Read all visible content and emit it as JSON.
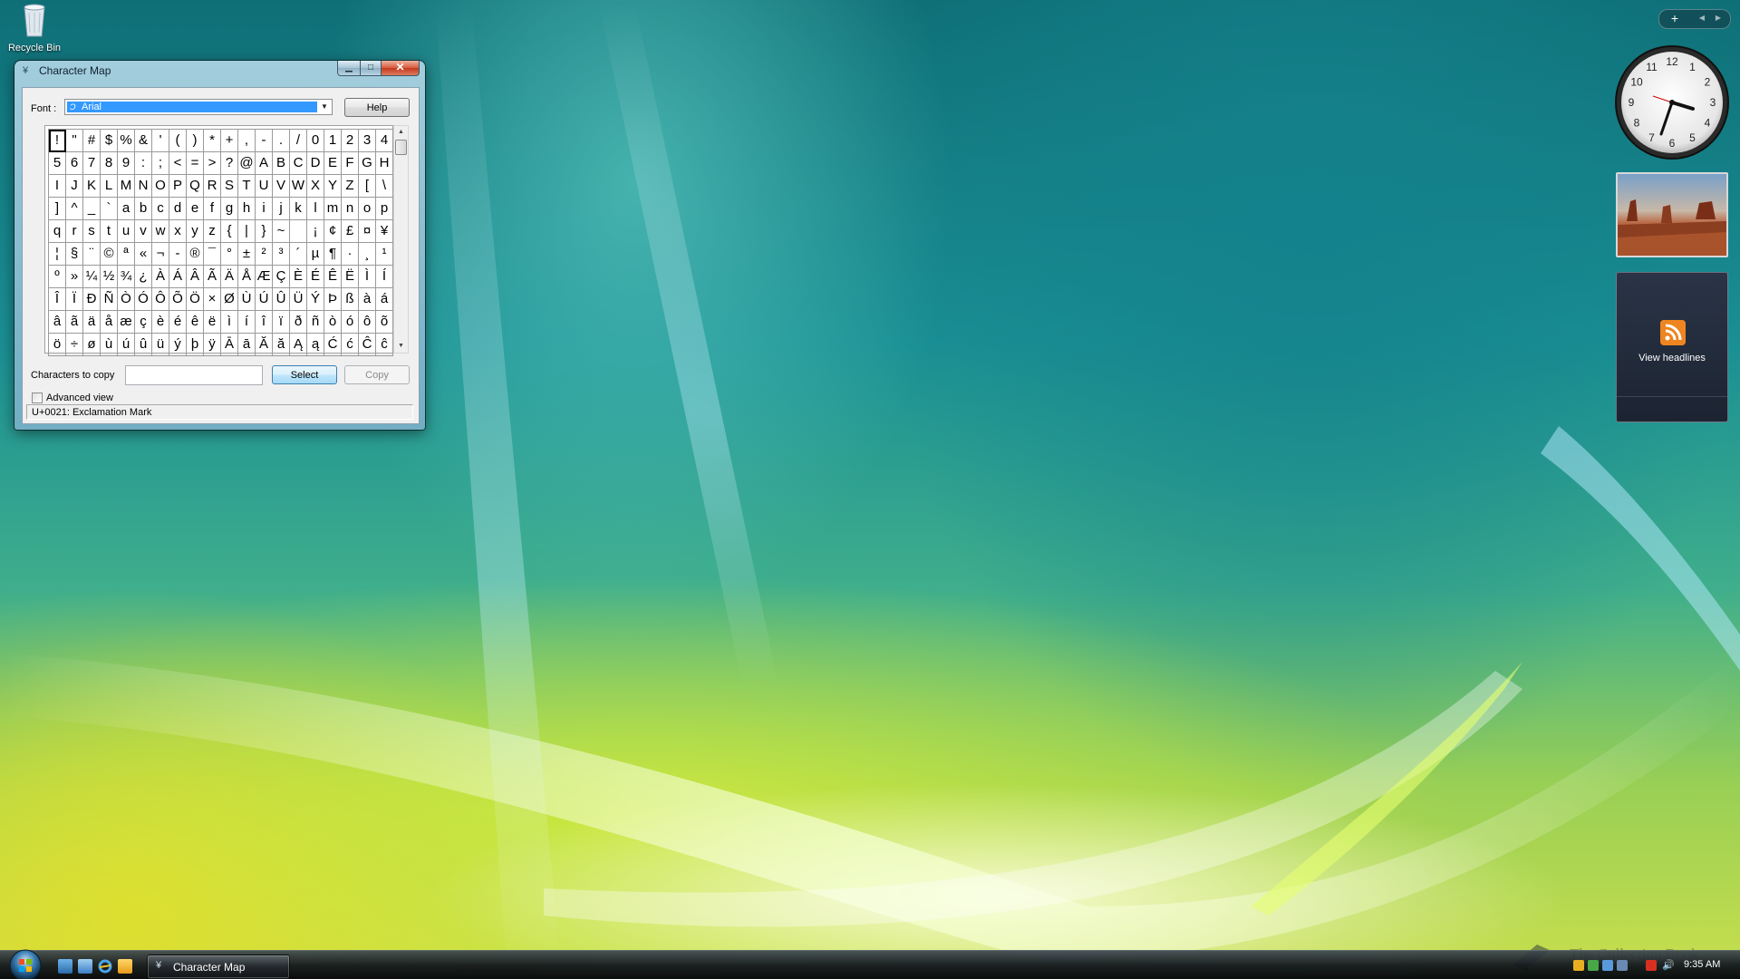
{
  "desktop": {
    "recycle_bin_label": "Recycle Bin"
  },
  "window": {
    "title": "Character Map",
    "font_label": "Font :",
    "font_value": "Arial",
    "font_icon_glyph": "Ɔ",
    "help_label": "Help",
    "characters": [
      "!",
      "\"",
      "#",
      "$",
      "%",
      "&",
      "'",
      "(",
      ")",
      "*",
      "+",
      ",",
      "-",
      ".",
      "/",
      "0",
      "1",
      "2",
      "3",
      "4",
      "5",
      "6",
      "7",
      "8",
      "9",
      ":",
      ";",
      "<",
      "=",
      ">",
      "?",
      "@",
      "A",
      "B",
      "C",
      "D",
      "E",
      "F",
      "G",
      "H",
      "I",
      "J",
      "K",
      "L",
      "M",
      "N",
      "O",
      "P",
      "Q",
      "R",
      "S",
      "T",
      "U",
      "V",
      "W",
      "X",
      "Y",
      "Z",
      "[",
      "\\",
      "]",
      "^",
      "_",
      "`",
      "a",
      "b",
      "c",
      "d",
      "e",
      "f",
      "g",
      "h",
      "i",
      "j",
      "k",
      "l",
      "m",
      "n",
      "o",
      "p",
      "q",
      "r",
      "s",
      "t",
      "u",
      "v",
      "w",
      "x",
      "y",
      "z",
      "{",
      "|",
      "}",
      "~",
      " ",
      "¡",
      "¢",
      "£",
      "¤",
      "¥",
      "¦",
      "§",
      "¨",
      "©",
      "ª",
      "«",
      "¬",
      "-",
      "®",
      "¯",
      "°",
      "±",
      "²",
      "³",
      "´",
      "µ",
      "¶",
      "·",
      "¸",
      "¹",
      "º",
      "»",
      "¼",
      "½",
      "¾",
      "¿",
      "À",
      "Á",
      "Â",
      "Ã",
      "Ä",
      "Å",
      "Æ",
      "Ç",
      "È",
      "É",
      "Ê",
      "Ë",
      "Ì",
      "Í",
      "Î",
      "Ï",
      "Ð",
      "Ñ",
      "Ò",
      "Ó",
      "Ô",
      "Õ",
      "Ö",
      "×",
      "Ø",
      "Ù",
      "Ú",
      "Û",
      "Ü",
      "Ý",
      "Þ",
      "ß",
      "à",
      "á",
      "â",
      "ã",
      "ä",
      "å",
      "æ",
      "ç",
      "è",
      "é",
      "ê",
      "ë",
      "ì",
      "í",
      "î",
      "ï",
      "ð",
      "ñ",
      "ò",
      "ó",
      "ô",
      "õ",
      "ö",
      "÷",
      "ø",
      "ù",
      "ú",
      "û",
      "ü",
      "ý",
      "þ",
      "ÿ",
      "Ā",
      "ā",
      "Ă",
      "ă",
      "Ą",
      "ą",
      "Ć",
      "ć",
      "Ĉ",
      "ĉ"
    ],
    "selected_index": 0,
    "copy_label": "Characters to copy",
    "copy_value": "",
    "select_label": "Select",
    "copy_button_label": "Copy",
    "advanced_view_label": "Advanced view",
    "status_text": "U+0021: Exclamation Mark"
  },
  "gadgets": {
    "add_symbol": "+",
    "feed_label": "View headlines",
    "clock_numerals": [
      "12",
      "1",
      "2",
      "3",
      "4",
      "5",
      "6",
      "7",
      "8",
      "9",
      "10",
      "11"
    ]
  },
  "taskbar": {
    "task_label": "Character Map",
    "clock": "9:35 AM"
  },
  "watermark": {
    "text": "The Collection Book"
  }
}
